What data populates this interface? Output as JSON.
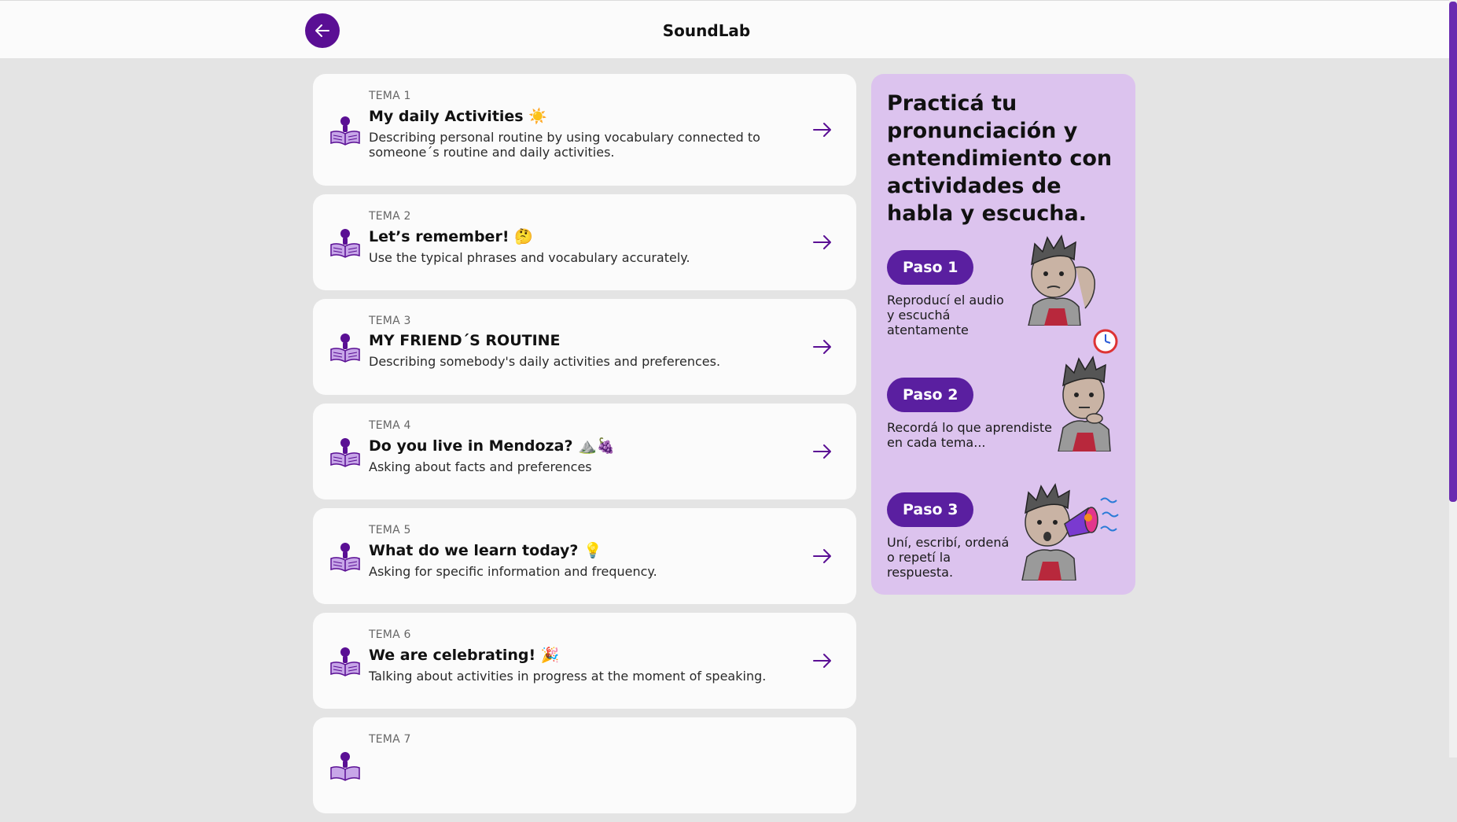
{
  "header": {
    "title": "SoundLab",
    "back_icon": "arrow-left-icon"
  },
  "topics": [
    {
      "label": "TEMA 1",
      "title": "My daily Activities ☀️",
      "desc": "Describing personal routine by using vocabulary connected to someone´s routine and daily activities."
    },
    {
      "label": "TEMA 2",
      "title": "Let’s remember! 🤔",
      "desc": "Use the typical phrases and vocabulary accurately."
    },
    {
      "label": "TEMA 3",
      "title": "MY FRIEND´S ROUTINE",
      "desc": "Describing somebody's daily activities and preferences."
    },
    {
      "label": "TEMA 4",
      "title": "Do you live in Mendoza? ⛰️🍇",
      "desc": "Asking about facts and preferences"
    },
    {
      "label": "TEMA 5",
      "title": "What do we learn today? 💡",
      "desc": "Asking for specific information and frequency."
    },
    {
      "label": "TEMA 6",
      "title": "We are celebrating! 🎉",
      "desc": "Talking about activities in progress at the moment of speaking."
    },
    {
      "label": "TEMA 7",
      "title": "",
      "desc": ""
    }
  ],
  "panel": {
    "heading": "Practicá tu pronunciación y entendimiento con actividades de habla y escucha.",
    "steps": [
      {
        "label": "Paso 1",
        "desc": "Reproducí el audio y escuchá atentamente",
        "illustration": "thinking-boy-illustration"
      },
      {
        "label": "Paso 2",
        "desc": "Recordá lo que aprendiste en cada tema...",
        "illustration": "stopwatch-boy-illustration"
      },
      {
        "label": "Paso 3",
        "desc": "Uní, escribí, ordená o repetí la respuesta.",
        "illustration": "megaphone-boy-illustration"
      }
    ]
  },
  "colors": {
    "accent": "#5a0f94",
    "pill": "#5a1fa0",
    "panel_bg": "#dcc3ee",
    "card_bg": "#fbfbfb",
    "page_bg": "#e4e4e4"
  }
}
